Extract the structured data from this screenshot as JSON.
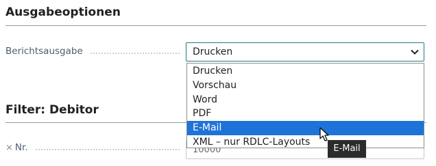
{
  "options_section": {
    "title": "Ausgabeoptionen"
  },
  "report_output": {
    "label": "Berichtsausgabe",
    "selected": "Drucken",
    "options": [
      "Drucken",
      "Vorschau",
      "Word",
      "PDF",
      "E-Mail",
      "XML – nur RDLC-Layouts"
    ],
    "highlighted": "E-Mail"
  },
  "filter_section": {
    "title": "Filter: Debitor"
  },
  "filter_field": {
    "label": "Nr.",
    "remove_glyph": "×",
    "value": "10000"
  },
  "tooltip": {
    "text": "E-Mail"
  },
  "icons": {
    "dropdown": "chevron-down-icon",
    "remove": "close-icon",
    "cursor": "mouse-pointer-icon"
  },
  "colors": {
    "accent_border": "#1f7a7f",
    "selected_option": "#1e73d8",
    "tooltip_bg": "#2b2b2b"
  }
}
